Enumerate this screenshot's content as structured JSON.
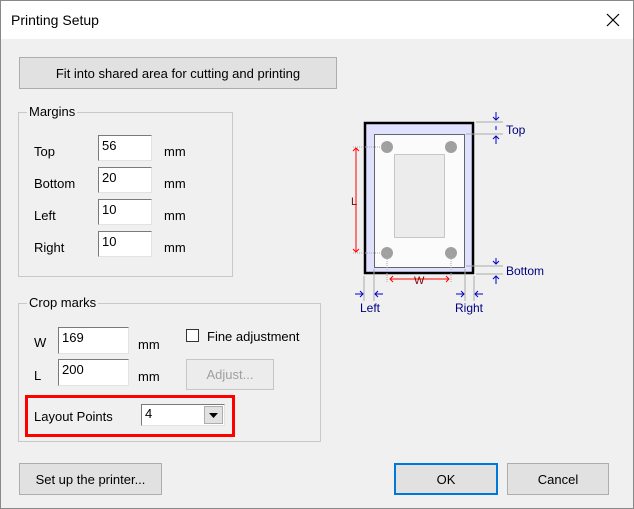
{
  "window": {
    "title": "Printing Setup",
    "close_icon": "close-icon"
  },
  "fit_button": "Fit into shared area for cutting and printing",
  "margins": {
    "legend": "Margins",
    "unit": "mm",
    "rows": [
      {
        "label": "Top",
        "value": "56"
      },
      {
        "label": "Bottom",
        "value": "20"
      },
      {
        "label": "Left",
        "value": "10"
      },
      {
        "label": "Right",
        "value": "10"
      }
    ]
  },
  "crop_marks": {
    "legend": "Crop marks",
    "unit": "mm",
    "w_label": "W",
    "w_value": "169",
    "l_label": "L",
    "l_value": "200",
    "fine_adjustment": "Fine adjustment",
    "fine_adjustment_checked": false,
    "adjust_button": "Adjust...",
    "layout_points_label": "Layout Points",
    "layout_points_value": "4",
    "highlight_color": "#ff0000"
  },
  "diagram": {
    "top": "Top",
    "bottom": "Bottom",
    "left": "Left",
    "right": "Right",
    "w": "W",
    "l": "L"
  },
  "footer": {
    "printer_button": "Set up the printer...",
    "ok": "OK",
    "cancel": "Cancel"
  }
}
